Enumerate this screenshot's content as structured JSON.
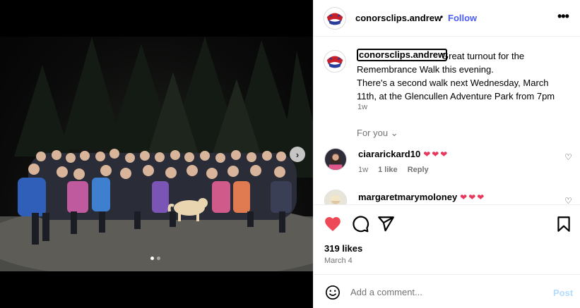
{
  "post": {
    "username": "conorsclips.andrew",
    "separator": "•",
    "follow_label": "Follow",
    "more_icon": "more-options-icon",
    "avatar_logo": "conorsclips-logo",
    "avatar_text": "CONOR'S CLIPS",
    "caption_lines": [
      "Great turnout for the",
      "Remembrance Walk this evening.",
      "There's a second walk next Wednesday, March",
      "11th, at the Glencullen Adventure Park from 7pm"
    ],
    "caption_time": "1w",
    "for_you_label": "For you",
    "comments": [
      {
        "username": "ciararickard10",
        "hearts": "❤❤❤",
        "time": "1w",
        "likes": "1 like",
        "reply": "Reply"
      },
      {
        "username": "margaretmarymoloney",
        "hearts": "❤❤❤"
      }
    ],
    "likes_text": "319 likes",
    "date_text": "March 4",
    "liked": true,
    "add_comment_placeholder": "Add a comment...",
    "post_label": "Post"
  },
  "media": {
    "slide_index": 1,
    "slide_count": 2
  },
  "colors": {
    "accent": "#4a5df9",
    "heart": "#ed4956",
    "post_disabled": "#b3dbff",
    "muted": "#737373"
  }
}
